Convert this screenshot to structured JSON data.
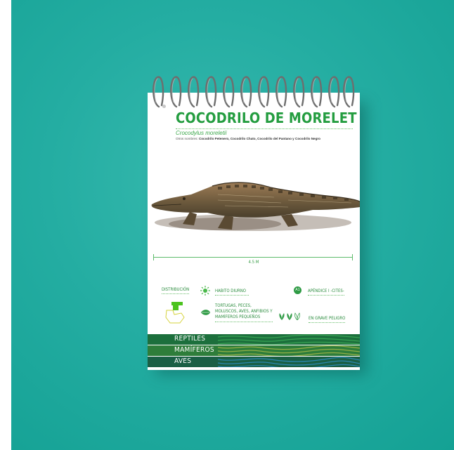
{
  "card": {
    "title": "COCODRILO DE MORELET",
    "scientific_name": "Crocodylus moreletii",
    "other_names_label": "Otros nombres:",
    "other_names": "Cocodrilo Petenero, Cocodrilo Chato, Cocodrilo del Pantano y Cocodrilo Negro",
    "size_label": "4.5 M",
    "distribution_label": "DISTRIBUCIÓN",
    "habit": "HABITO DIURNO",
    "diet": [
      "TORTUGAS, PECES,",
      "MOLUSCOS, AVES, ANFIBIOS Y",
      "MAMÍFEROS PEQUEÑOS"
    ],
    "cites_badge": "A1",
    "cites_label": "APÉNDICE I -CITES-",
    "status_label": "EN GRAVE PELIGRO",
    "status_level": {
      "filled": 2,
      "total": 3
    }
  },
  "categories": [
    {
      "label": "REPTILES",
      "color": "#1c6f3c"
    },
    {
      "label": "MAMÍFEROS",
      "color": "#2e7d3a"
    },
    {
      "label": "AVES",
      "color": "#1a5f45"
    }
  ],
  "colors": {
    "background": "#24ada2",
    "accent_green": "#249d40",
    "band_dark": "#1c6f3c"
  },
  "icons": [
    "sun-icon",
    "leaf-icon",
    "plant-icon",
    "map-icon",
    "cites-badge-icon"
  ]
}
